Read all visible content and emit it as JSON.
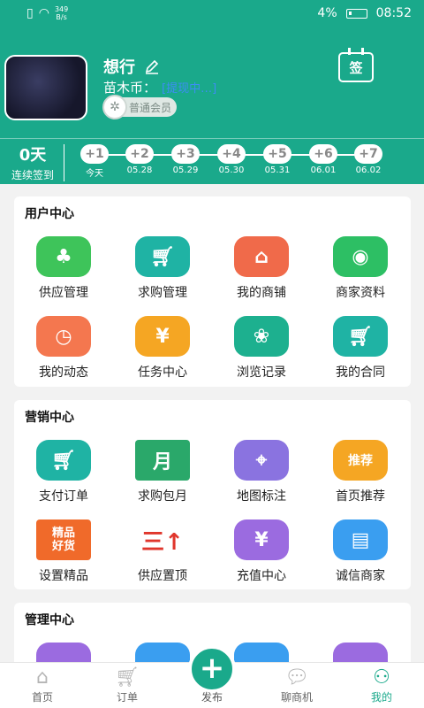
{
  "statusbar": {
    "speed_top": "349",
    "speed_unit": "B/s",
    "battery": "4%",
    "time": "08:52"
  },
  "profile": {
    "name": "想行",
    "coins_label": "苗木币：",
    "coins_link": "[提现中…]",
    "member": "普通会员",
    "signin_label": "签"
  },
  "streak": {
    "days": "0天",
    "label": "连续签到",
    "items": [
      {
        "bonus": "+1",
        "date": "今天"
      },
      {
        "bonus": "+2",
        "date": "05.28"
      },
      {
        "bonus": "+3",
        "date": "05.29"
      },
      {
        "bonus": "+4",
        "date": "05.30"
      },
      {
        "bonus": "+5",
        "date": "05.31"
      },
      {
        "bonus": "+6",
        "date": "06.01"
      },
      {
        "bonus": "+7",
        "date": "06.02"
      }
    ]
  },
  "user_center": {
    "title": "用户中心",
    "items": [
      {
        "label": "供应管理",
        "icon": "tree-icon",
        "color": "#3ec45a"
      },
      {
        "label": "求购管理",
        "icon": "cart-icon",
        "color": "#1fb3a4"
      },
      {
        "label": "我的商铺",
        "icon": "shop-icon",
        "color": "#f06a4a"
      },
      {
        "label": "商家资料",
        "icon": "person-icon",
        "color": "#2dbf64"
      },
      {
        "label": "我的动态",
        "icon": "alarm-clock-icon",
        "color": "#f4774f"
      },
      {
        "label": "任务中心",
        "icon": "coins-icon",
        "color": "#f5a623"
      },
      {
        "label": "浏览记录",
        "icon": "paw-icon",
        "color": "#1db08f"
      },
      {
        "label": "我的合同",
        "icon": "cart-icon",
        "color": "#1fb3a4"
      }
    ]
  },
  "marketing_center": {
    "title": "营销中心",
    "items": [
      {
        "label": "支付订单",
        "icon": "cart-icon",
        "color": "#1fb3a4"
      },
      {
        "label": "求购包月",
        "icon": "gift-box-icon",
        "color": "#2aa86a",
        "glyph": "月"
      },
      {
        "label": "地图标注",
        "icon": "map-icon",
        "color": "#8a73e0"
      },
      {
        "label": "首页推荐",
        "icon": "thumbs-up-icon",
        "color": "#f5a623",
        "glyph": "推荐"
      },
      {
        "label": "设置精品",
        "icon": "quality-badge-icon",
        "color": "#f06a2a",
        "glyph": "精品好货"
      },
      {
        "label": "供应置顶",
        "icon": "pin-top-icon",
        "color": "#e0362c",
        "glyph": "三↑"
      },
      {
        "label": "充值中心",
        "icon": "recharge-icon",
        "color": "#9b6be0",
        "glyph": "¥"
      },
      {
        "label": "诚信商家",
        "icon": "id-card-icon",
        "color": "#3a9ef0"
      }
    ]
  },
  "management_center": {
    "title": "管理中心"
  },
  "tabbar": {
    "home": "首页",
    "orders": "订单",
    "publish": "发布",
    "chat": "聊商机",
    "mine": "我的"
  }
}
